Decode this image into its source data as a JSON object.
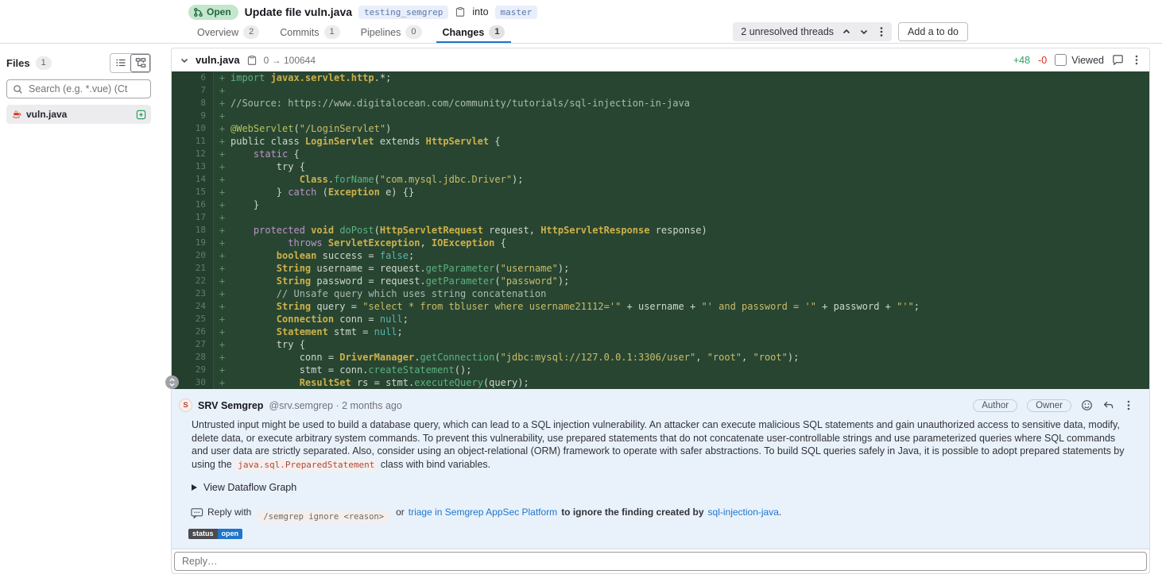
{
  "colors": {
    "open_badge_bg": "#c3e6cd",
    "open_badge_text": "#24663b",
    "active_tab_indicator": "#1f75cb",
    "link_blue": "#1f75cb",
    "added_stat_green": "#2da160",
    "removed_stat_red": "#dd2b0e",
    "code_bg": "#284532",
    "code_gutter_bg": "#243f2d",
    "thread_bg": "#e9f2fb",
    "status_label_bg": "#4c4c50",
    "status_value_bg": "#1f75cb",
    "file_icon_red": "#db3b21",
    "added_file_icon_green": "#2da160"
  },
  "icons": {
    "state_badge": "merge-request-icon",
    "branch_copy": "clipboard-icon",
    "threads_prev": "chevron-up-icon",
    "threads_next": "chevron-down-icon",
    "threads_menu": "kebab-menu-icon",
    "sidebar_list": "list-view-icon",
    "sidebar_tree": "tree-view-icon",
    "search": "search-icon",
    "file": "java-file-icon",
    "file_added": "plus-square-icon",
    "file_collapse": "chevron-down-icon",
    "file_copy": "clipboard-icon",
    "file_comment": "comment-bubble-icon",
    "file_menu": "kebab-menu-icon",
    "expand_lines": "unfold-lines-icon",
    "award_emoji": "smiley-icon",
    "reply_note": "reply-arrow-icon",
    "note_menu": "kebab-menu-icon",
    "reply_hint": "comment-dots-icon",
    "dataflow_toggle": "triangle-right-icon"
  },
  "header": {
    "state_badge": "Open",
    "title": "Update file vuln.java",
    "source_branch": "testing_semgrep",
    "into_label": "into",
    "target_branch": "master",
    "tabs": [
      {
        "label": "Overview",
        "count": "2"
      },
      {
        "label": "Commits",
        "count": "1"
      },
      {
        "label": "Pipelines",
        "count": "0"
      },
      {
        "label": "Changes",
        "count": "1"
      }
    ],
    "unresolved_label": "2 unresolved threads",
    "todo_button": "Add a to do"
  },
  "sidebar": {
    "files_label": "Files",
    "files_count": "1",
    "search_placeholder": "Search (e.g. *.vue) (Ct",
    "file_name": "vuln.java"
  },
  "diff": {
    "file_name": "vuln.java",
    "mode_change": "0 → 100644",
    "added": "+48",
    "removed": "-0",
    "viewed_label": "Viewed",
    "sign": "+",
    "lines": [
      {
        "n": 6,
        "segs": [
          [
            "fn",
            "import "
          ],
          [
            "ty",
            "javax.servlet.http"
          ],
          [
            "pl",
            ".*;"
          ]
        ]
      },
      {
        "n": 7,
        "segs": []
      },
      {
        "n": 8,
        "segs": [
          [
            "cm",
            "//Source: https://www.digitalocean.com/community/tutorials/sql-injection-in-java"
          ]
        ]
      },
      {
        "n": 9,
        "segs": []
      },
      {
        "n": 10,
        "segs": [
          [
            "an",
            "@WebServlet"
          ],
          [
            "pl",
            "("
          ],
          [
            "st",
            "\"/LoginServlet\""
          ],
          [
            "pl",
            ")"
          ]
        ]
      },
      {
        "n": 11,
        "segs": [
          [
            "pl",
            "public class "
          ],
          [
            "ty",
            "LoginServlet"
          ],
          [
            "pl",
            " extends "
          ],
          [
            "ty",
            "HttpServlet"
          ],
          [
            "pl",
            " {"
          ]
        ]
      },
      {
        "n": 12,
        "segs": [
          [
            "pl",
            "    "
          ],
          [
            "kw",
            "static"
          ],
          [
            "pl",
            " {"
          ]
        ]
      },
      {
        "n": 13,
        "segs": [
          [
            "pl",
            "        try {"
          ]
        ]
      },
      {
        "n": 14,
        "segs": [
          [
            "pl",
            "            "
          ],
          [
            "ty",
            "Class"
          ],
          [
            "pl",
            "."
          ],
          [
            "fn",
            "forName"
          ],
          [
            "pl",
            "("
          ],
          [
            "st",
            "\"com.mysql.jdbc.Driver\""
          ],
          [
            "pl",
            ");"
          ]
        ]
      },
      {
        "n": 15,
        "segs": [
          [
            "pl",
            "        } "
          ],
          [
            "kw",
            "catch"
          ],
          [
            "pl",
            " ("
          ],
          [
            "ty",
            "Exception"
          ],
          [
            "pl",
            " e) {}"
          ]
        ]
      },
      {
        "n": 16,
        "segs": [
          [
            "pl",
            "    }"
          ]
        ]
      },
      {
        "n": 17,
        "segs": []
      },
      {
        "n": 18,
        "segs": [
          [
            "pl",
            "    "
          ],
          [
            "kw",
            "protected"
          ],
          [
            "pl",
            " "
          ],
          [
            "ty",
            "void"
          ],
          [
            "pl",
            " "
          ],
          [
            "fn",
            "doPost"
          ],
          [
            "pl",
            "("
          ],
          [
            "ty",
            "HttpServletRequest"
          ],
          [
            "pl",
            " request, "
          ],
          [
            "ty",
            "HttpServletResponse"
          ],
          [
            "pl",
            " response)"
          ]
        ]
      },
      {
        "n": 19,
        "segs": [
          [
            "pl",
            "          "
          ],
          [
            "kw",
            "throws"
          ],
          [
            "pl",
            " "
          ],
          [
            "ty",
            "ServletException"
          ],
          [
            "pl",
            ", "
          ],
          [
            "ty",
            "IOException"
          ],
          [
            "pl",
            " {"
          ]
        ]
      },
      {
        "n": 20,
        "segs": [
          [
            "pl",
            "        "
          ],
          [
            "ty",
            "boolean"
          ],
          [
            "pl",
            " success = "
          ],
          [
            "nu",
            "false"
          ],
          [
            "pl",
            ";"
          ]
        ]
      },
      {
        "n": 21,
        "segs": [
          [
            "pl",
            "        "
          ],
          [
            "ty",
            "String"
          ],
          [
            "pl",
            " username = request."
          ],
          [
            "fn",
            "getParameter"
          ],
          [
            "pl",
            "("
          ],
          [
            "st",
            "\"username\""
          ],
          [
            "pl",
            ");"
          ]
        ]
      },
      {
        "n": 22,
        "segs": [
          [
            "pl",
            "        "
          ],
          [
            "ty",
            "String"
          ],
          [
            "pl",
            " password = request."
          ],
          [
            "fn",
            "getParameter"
          ],
          [
            "pl",
            "("
          ],
          [
            "st",
            "\"password\""
          ],
          [
            "pl",
            ");"
          ]
        ]
      },
      {
        "n": 23,
        "segs": [
          [
            "pl",
            "        "
          ],
          [
            "cm",
            "// Unsafe query which uses string concatenation"
          ]
        ]
      },
      {
        "n": 24,
        "segs": [
          [
            "pl",
            "        "
          ],
          [
            "ty",
            "String"
          ],
          [
            "pl",
            " query = "
          ],
          [
            "st",
            "\"select * from tbluser where username21112='\""
          ],
          [
            "pl",
            " + username + "
          ],
          [
            "st",
            "\"' and password = '\""
          ],
          [
            "pl",
            " + password + "
          ],
          [
            "st",
            "\"'\""
          ],
          [
            "pl",
            ";"
          ]
        ]
      },
      {
        "n": 25,
        "segs": [
          [
            "pl",
            "        "
          ],
          [
            "ty",
            "Connection"
          ],
          [
            "pl",
            " conn = "
          ],
          [
            "nu",
            "null"
          ],
          [
            "pl",
            ";"
          ]
        ]
      },
      {
        "n": 26,
        "segs": [
          [
            "pl",
            "        "
          ],
          [
            "ty",
            "Statement"
          ],
          [
            "pl",
            " stmt = "
          ],
          [
            "nu",
            "null"
          ],
          [
            "pl",
            ";"
          ]
        ]
      },
      {
        "n": 27,
        "segs": [
          [
            "pl",
            "        try {"
          ]
        ]
      },
      {
        "n": 28,
        "segs": [
          [
            "pl",
            "            conn = "
          ],
          [
            "ty",
            "DriverManager"
          ],
          [
            "pl",
            "."
          ],
          [
            "fn",
            "getConnection"
          ],
          [
            "pl",
            "("
          ],
          [
            "st",
            "\"jdbc:mysql://127.0.0.1:3306/user\""
          ],
          [
            "pl",
            ", "
          ],
          [
            "st",
            "\"root\""
          ],
          [
            "pl",
            ", "
          ],
          [
            "st",
            "\"root\""
          ],
          [
            "pl",
            ");"
          ]
        ]
      },
      {
        "n": 29,
        "segs": [
          [
            "pl",
            "            stmt = conn."
          ],
          [
            "fn",
            "createStatement"
          ],
          [
            "pl",
            "();"
          ]
        ]
      },
      {
        "n": 30,
        "segs": [
          [
            "pl",
            "            "
          ],
          [
            "ty",
            "ResultSet"
          ],
          [
            "pl",
            " rs = stmt."
          ],
          [
            "fn",
            "executeQuery"
          ],
          [
            "pl",
            "(query);"
          ]
        ]
      }
    ]
  },
  "discussion": {
    "avatar_initial": "S",
    "author": "SRV Semgrep",
    "meta": "@srv.semgrep · 2 months ago",
    "badges": [
      "Author",
      "Owner"
    ],
    "body_text": "Untrusted input might be used to build a database query, which can lead to a SQL injection vulnerability. An attacker can execute malicious SQL statements and gain unauthorized access to sensitive data, modify, delete data, or execute arbitrary system commands. To prevent this vulnerability, use prepared statements that do not concatenate user-controllable strings and use parameterized queries where SQL commands and user data are strictly separated. Also, consider using an object-relational (ORM) framework to operate with safer abstractions. To build SQL queries safely in Java, it is possible to adopt prepared statements by using the ",
    "inline_code": "java.sql.PreparedStatement",
    "body_tail": " class with bind variables.",
    "dataflow_label": "View Dataflow Graph",
    "reply_hint": {
      "prefix": "Reply with",
      "command": "/semgrep ignore <reason>",
      "or_label": "or",
      "platform_link": "triage in Semgrep AppSec Platform",
      "middle": "to ignore the finding created by",
      "rule_link": "sql-injection-java",
      "suffix": "."
    },
    "status": {
      "label": "status",
      "value": "open"
    },
    "reply_placeholder": "Reply…"
  }
}
